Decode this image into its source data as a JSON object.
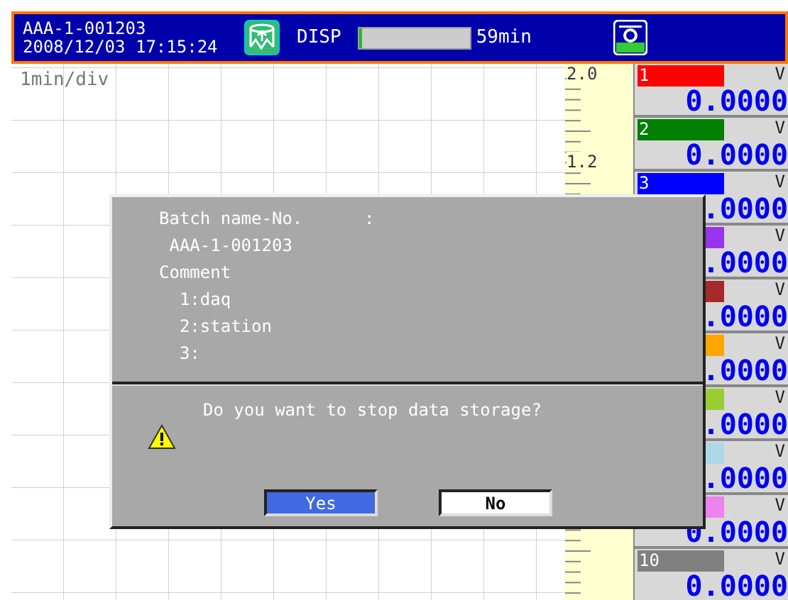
{
  "header": {
    "batch": "AAA-1-001203",
    "datetime": "2008/12/03 17:15:24",
    "mode": "DISP",
    "memory": {
      "level": 0.02
    },
    "remaining": "59min"
  },
  "chart": {
    "time_div": "1min/div",
    "scale_labels": [
      "2.0",
      "1.2"
    ]
  },
  "channels": [
    {
      "label": "1",
      "color": "#ff0000",
      "unit": "V",
      "value": "0.0000"
    },
    {
      "label": "2",
      "color": "#008000",
      "unit": "V",
      "value": "0.0000"
    },
    {
      "label": "3",
      "color": "#0000ff",
      "unit": "V",
      "value": ".0000"
    },
    {
      "color": "#9933ee",
      "unit": "V",
      "value": ".0000"
    },
    {
      "color": "#a52a2a",
      "unit": "V",
      "value": ".0000"
    },
    {
      "color": "#ffa500",
      "unit": "V",
      "value": ".0000"
    },
    {
      "color": "#9acd32",
      "unit": "V",
      "value": ".0000"
    },
    {
      "color": "#add8e6",
      "unit": "V",
      "value": ".0000"
    },
    {
      "color": "#ee82ee",
      "unit": "V",
      "value": "0.0000"
    },
    {
      "label": "10",
      "color": "#808080",
      "unit": "V",
      "value": "0.0000"
    }
  ],
  "dialog": {
    "info_lines": [
      "Batch name-No.      :",
      " AAA-1-001203",
      "Comment",
      "  1:daq",
      "  2:station",
      "  3:"
    ],
    "message": "Do you want to stop data storage?",
    "buttons": [
      {
        "label": "Yes",
        "selected": true
      },
      {
        "label": "No",
        "selected": false
      }
    ]
  }
}
